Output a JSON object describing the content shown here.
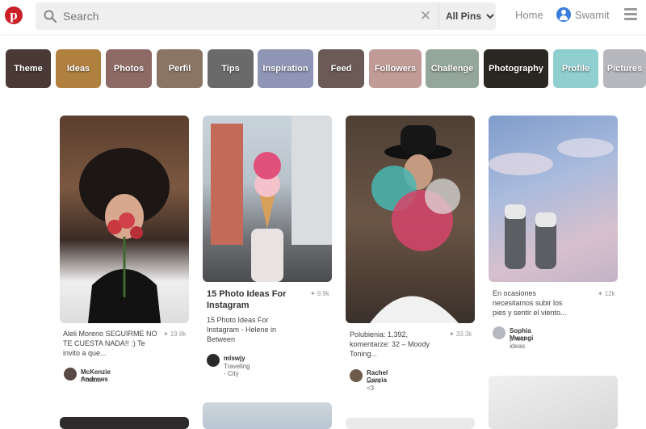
{
  "header": {
    "logo_letter": "p",
    "search_placeholder": "Search",
    "scope_label": "All Pins",
    "home_label": "Home",
    "username": "Swamit"
  },
  "categories": [
    {
      "label": "Theme",
      "color": "#4a3a36"
    },
    {
      "label": "Ideas",
      "color": "#b0803f"
    },
    {
      "label": "Photos",
      "color": "#8d6a66"
    },
    {
      "label": "Perfil",
      "color": "#8a7565"
    },
    {
      "label": "Tips",
      "color": "#6a6a6a"
    },
    {
      "label": "Inspiration",
      "color": "#8e95b5"
    },
    {
      "label": "Feed",
      "color": "#6b5a55"
    },
    {
      "label": "Followers",
      "color": "#c19b97"
    },
    {
      "label": "Challenge",
      "color": "#95a69a"
    },
    {
      "label": "Photography",
      "color": "#2a2622"
    },
    {
      "label": "Profile",
      "color": "#8fcfcf"
    },
    {
      "label": "Pictures",
      "color": "#b7b8bd"
    }
  ],
  "pins": [
    {
      "title": "",
      "description": "Aleli Moreno SEGUIRME NO TE CUESTA NADA!! :) Te invito a que...",
      "saves": "19.8k",
      "owner": "McKenzie Andrews",
      "board": "Photos",
      "colors": {
        "a": "#6b4a36",
        "b": "#2a2020",
        "c": "#c7383f"
      }
    },
    {
      "title": "15 Photo Ideas For Instagram",
      "description": "15 Photo Ideas For Instagram - Helene in Between",
      "saves": "9.9k",
      "owner": "mlswjy",
      "board": "Traveling - City",
      "colors": {
        "a": "#9aa8b5",
        "b": "#c46a59",
        "c": "#f0b7c0"
      }
    },
    {
      "title": "",
      "description": "Polubienia: 1,392, komentarze: 32 – Moody Toning...",
      "saves": "33.3k",
      "owner": "Rachel Garcia",
      "board": "Love <3",
      "colors": {
        "a": "#5d4a3c",
        "b": "#4ab7b3",
        "c": "#d6456b"
      }
    },
    {
      "title": "",
      "description": "En ocasiones necesitamos subir los pies y sentir el viento...",
      "saves": "12k",
      "owner": "Sophia Mwangi",
      "board": "photo ideas",
      "colors": {
        "a": "#8fa7cf",
        "b": "#d7c0cd",
        "c": "#e5e5e5"
      }
    }
  ]
}
